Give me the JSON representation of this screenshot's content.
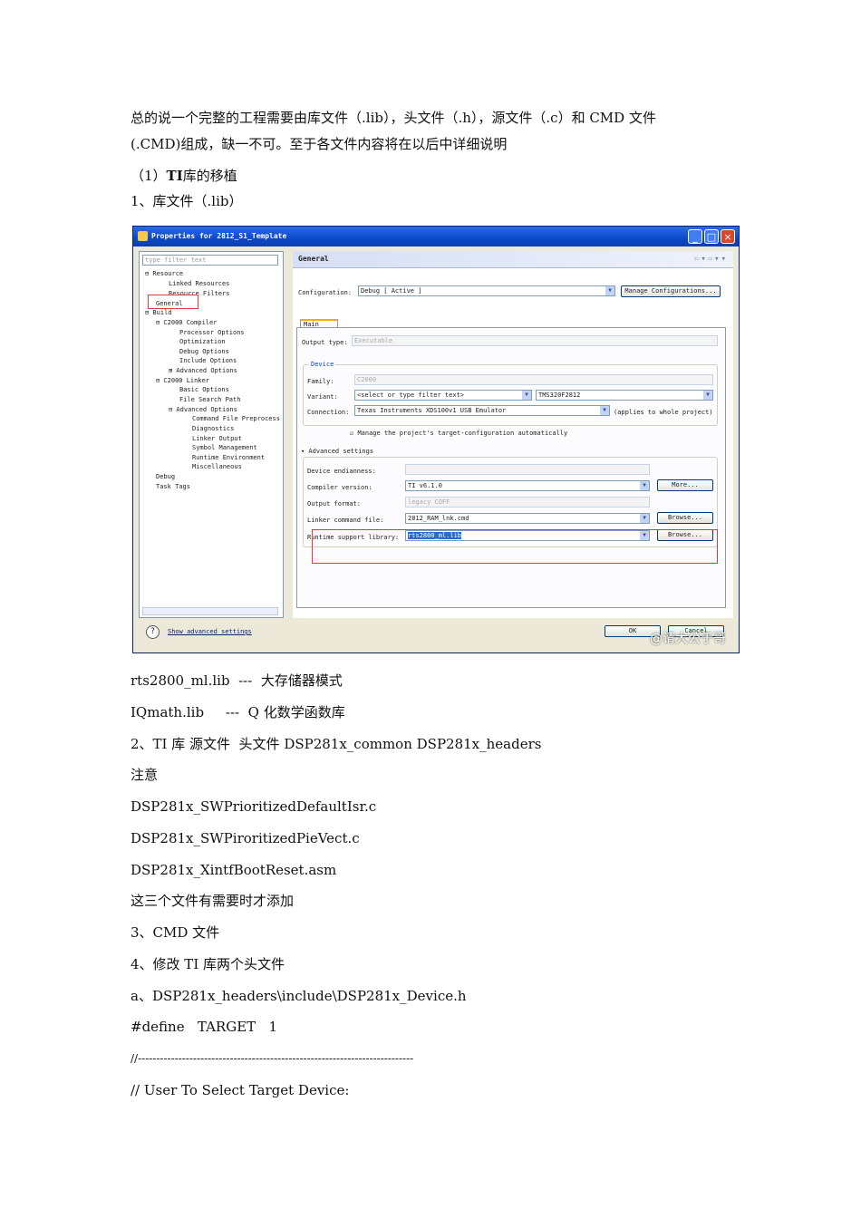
{
  "intro": {
    "line1": "总的说一个完整的工程需要由库文件（.lib），头文件（.h），源文件（.c）和 CMD 文件",
    "line2": "(.CMD)组成，缺一不可。至于各文件内容将在以后中详细说明"
  },
  "section1": {
    "prefix": "（1）",
    "bold": "TI",
    "rest": "库的移植"
  },
  "item_lib": "1、库文件（.lib）",
  "screenshot": {
    "window_title": "Properties for 2812_S1_Template",
    "filter_placeholder": "type filter text",
    "tree": [
      "⊟ Resource",
      "Linked Resources",
      "Resource Filters",
      "General",
      "⊟ Build",
      "⊟ C2000 Compiler",
      "Processor Options",
      "Optimization",
      "Debug Options",
      "Include Options",
      "⊞ Advanced Options",
      "⊟ C2000 Linker",
      "Basic Options",
      "File Search Path",
      "⊟ Advanced Options",
      "Command File Preprocess",
      "Diagnostics",
      "Linker Output",
      "Symbol Management",
      "Runtime Environment",
      "Miscellaneous",
      "Debug",
      "Task Tags"
    ],
    "header": "General",
    "config_label": "Configuration:",
    "config_value": "Debug  [ Active ]",
    "manage_button": "Manage Configurations...",
    "tab_main": "Main",
    "output_type_label": "Output type:",
    "output_type_value": "Executable",
    "device_group": "Device",
    "family_label": "Family:",
    "family_value": "C2000",
    "variant_label": "Variant:",
    "variant_filter": "<select or type filter text>",
    "variant_value": "TMS320F2812",
    "connection_label": "Connection:",
    "connection_value": "Texas Instruments XDS100v1 USB Emulator",
    "connection_note": "(applies to whole project)",
    "manage_target_checkbox": "Manage the project's target-configuration automatically",
    "advanced_settings": "▾ Advanced settings",
    "endianness_label": "Device endianness:",
    "compiler_label": "Compiler version:",
    "compiler_value": "TI v6.1.0",
    "more_button": "More...",
    "output_format_label": "Output format:",
    "output_format_value": "legacy COFF",
    "linker_label": "Linker command file:",
    "linker_value": "2812_RAM_lnk.cmd",
    "browse_button": "Browse...",
    "runtime_label": "Runtime support library:",
    "runtime_value": "rts2800_ml.lib",
    "show_advanced": "Show advanced settings",
    "ok_button": "OK",
    "cancel_button": "Cancel",
    "watermark": "@请大公于哥"
  },
  "lines": [
    "rts2800_ml.lib  ---  大存储器模式",
    "IQmath.lib     ---  Q 化数学函数库",
    "2、TI 库 源文件  头文件 DSP281x_common DSP281x_headers",
    "注意",
    "DSP281x_SWPrioritizedDefaultIsr.c",
    "DSP281x_SWPiroritizedPieVect.c",
    "DSP281x_XintfBootReset.asm",
    "这三个文件有需要时才添加",
    "3、CMD 文件",
    "4、修改 TI 库两个头文件",
    "a、DSP281x_headers\\include\\DSP281x_Device.h",
    "#define   TARGET   1",
    "//---------------------------------------------------------------------------",
    "// User To Select Target Device:"
  ]
}
